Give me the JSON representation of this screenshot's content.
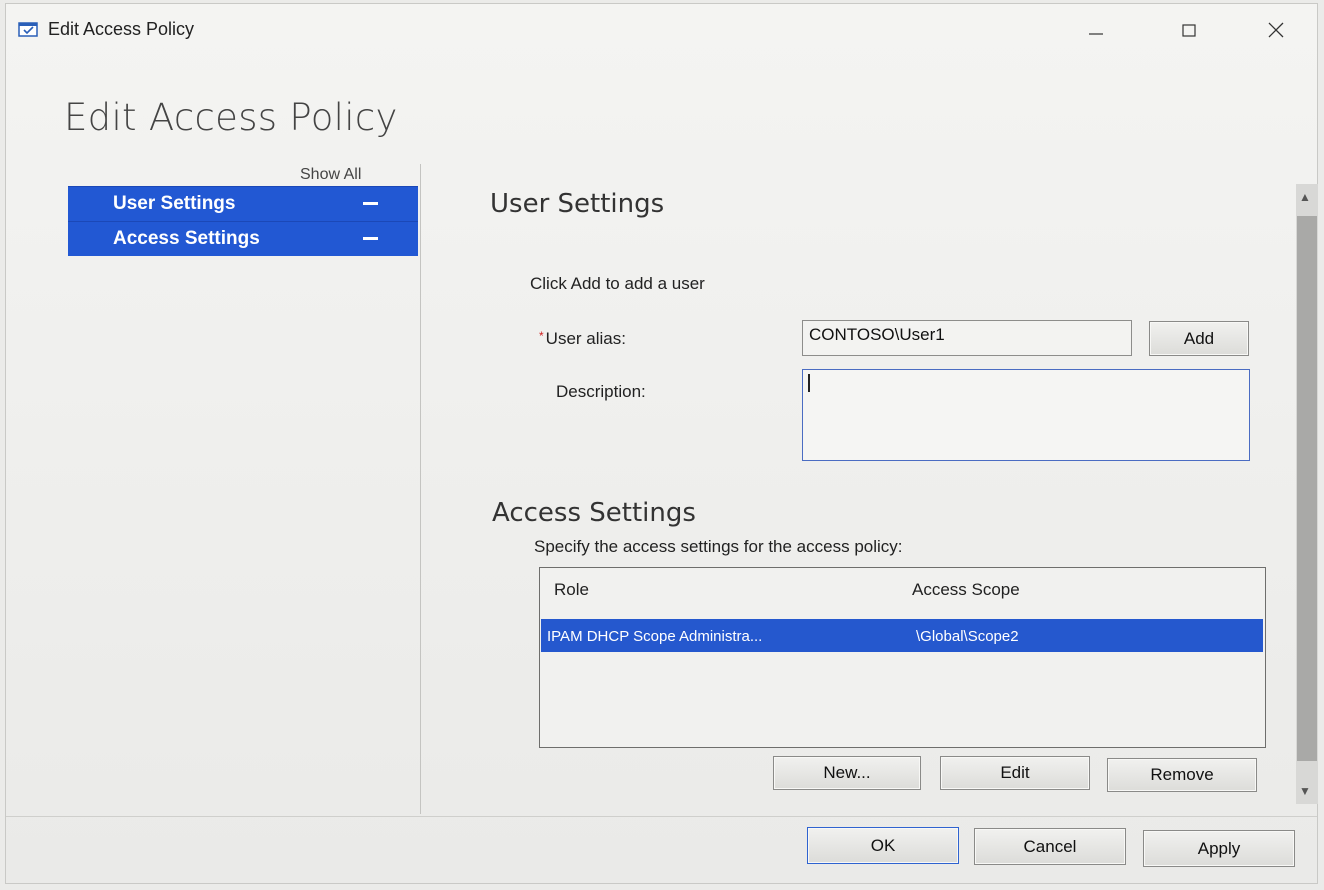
{
  "window": {
    "title": "Edit Access Policy",
    "icon": "policy-window-icon",
    "controls": [
      "minimize-icon",
      "maximize-icon",
      "close-icon"
    ]
  },
  "page": {
    "heading": "Edit Access Policy"
  },
  "nav": {
    "show_all": "Show All",
    "items": [
      {
        "label": "User Settings",
        "icon": "collapse-icon"
      },
      {
        "label": "Access Settings",
        "icon": "collapse-icon"
      }
    ],
    "accent_color": "#2258d3"
  },
  "user_settings": {
    "title": "User Settings",
    "instruction": "Click Add to add a user",
    "required_mark": "*",
    "alias_label": "User alias:",
    "alias_value": "CONTOSO\\User1",
    "add_button": "Add",
    "description_label": "Description:",
    "description_value": ""
  },
  "access_settings": {
    "title": "Access Settings",
    "instruction": "Specify the access settings for the access policy:",
    "columns": [
      "Role",
      "Access Scope"
    ],
    "rows": [
      {
        "role": "IPAM DHCP Scope Administra...",
        "scope": "\\Global\\Scope2",
        "selected": true
      }
    ],
    "buttons": {
      "new": "New...",
      "edit": "Edit",
      "remove": "Remove"
    }
  },
  "footer": {
    "ok": "OK",
    "cancel": "Cancel",
    "apply": "Apply"
  }
}
